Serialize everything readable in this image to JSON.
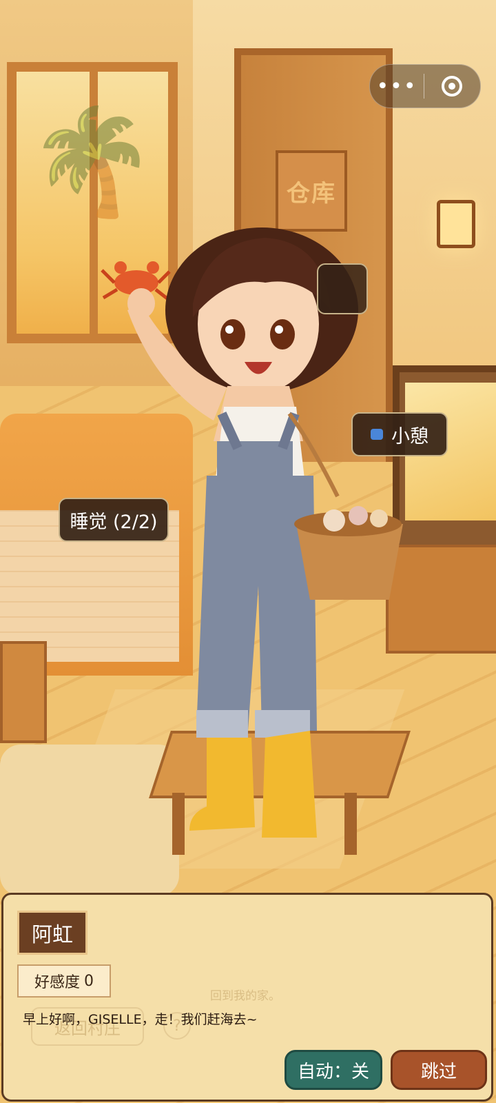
{
  "scene": {
    "door_sign": "仓库"
  },
  "hotspots": {
    "sleep": "睡觉 (2/2)",
    "rest": "小憩"
  },
  "top_capsule": {
    "more_icon": "more-dots-icon",
    "close_icon": "target-icon"
  },
  "dialog": {
    "speaker": "阿虹",
    "affinity_label": "好感度",
    "affinity_value": "0",
    "text": "早上好啊，GISELLE，走！我们赶海去~",
    "auto_label": "自动：关",
    "skip_label": "跳过",
    "faded_behind": {
      "back_button": "返回村庄",
      "help": "?",
      "note": "回到我的家。"
    }
  },
  "colors": {
    "dialog_bg": "#f5dfa9",
    "auto_btn": "#2f6f63",
    "skip_btn": "#a8532a",
    "name_tag": "#6b3f22"
  }
}
